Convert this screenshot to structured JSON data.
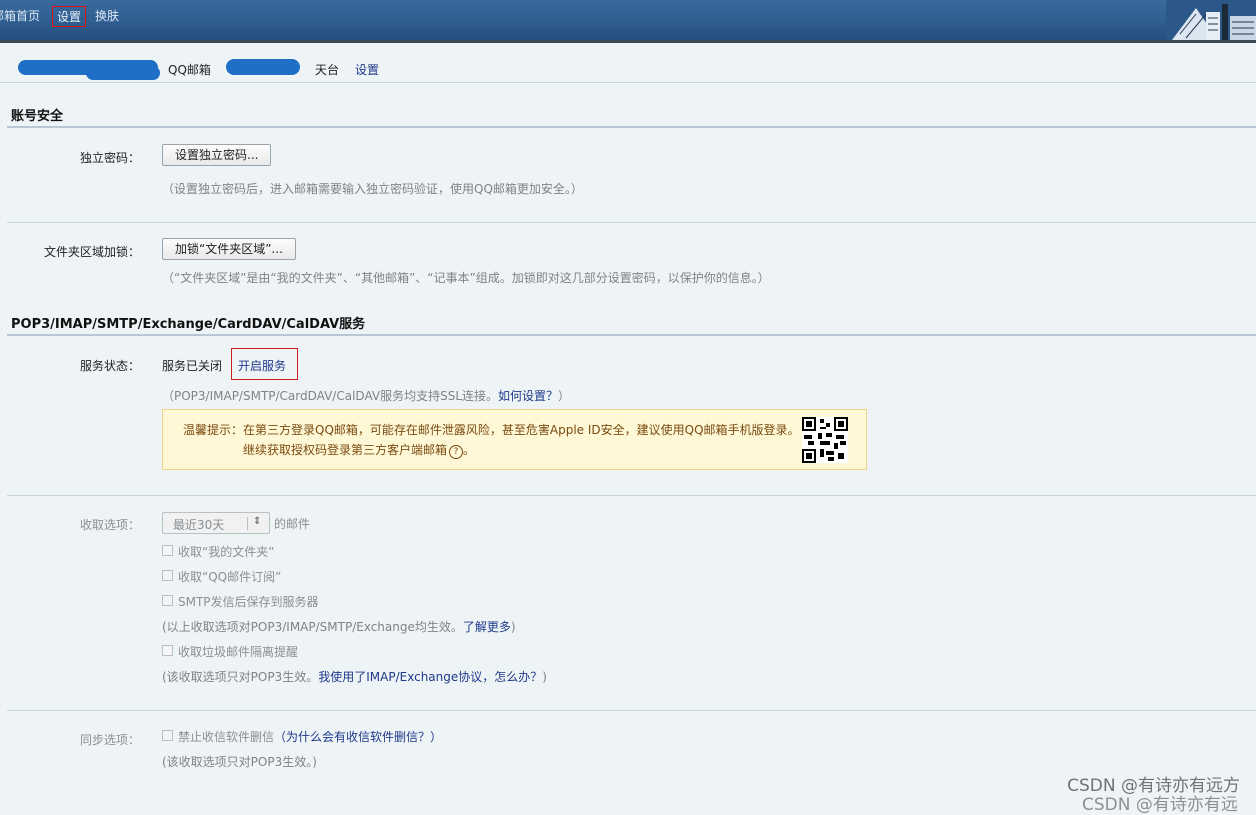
{
  "topnav": {
    "home": "邮箱首页",
    "settings": "设置",
    "skin": "换肤"
  },
  "account": {
    "product": "QQ邮箱",
    "tiantai": "天台",
    "settings_link": "设置"
  },
  "security": {
    "title": "账号安全",
    "independent_password": {
      "label": "独立密码：",
      "button": "设置独立密码...",
      "hint": "（设置独立密码后，进入邮箱需要输入独立密码验证，使用QQ邮箱更加安全。）"
    },
    "folder_lock": {
      "label": "文件夹区域加锁：",
      "button": "加锁“文件夹区域”...",
      "hint": "（“文件夹区域”是由“我的文件夹”、“其他邮箱”、“记事本”组成。加锁即对这几部分设置密码，以保护你的信息。）"
    }
  },
  "service": {
    "title": "POP3/IMAP/SMTP/Exchange/CardDAV/CalDAV服务",
    "status_label": "服务状态：",
    "status_value": "服务已关闭",
    "enable_link": "开启服务",
    "ssl_hint": "（POP3/IMAP/SMTP/CardDAV/CalDAV服务均支持SSL连接。",
    "ssl_link": "如何设置？",
    "ssl_close": "）",
    "warning_line1": "温馨提示：在第三方登录QQ邮箱，可能存在邮件泄露风险，甚至危害Apple ID安全，建议使用QQ邮箱手机版登录。",
    "warning_line2": "继续获取授权码登录第三方客户端邮箱",
    "warning_q": "?",
    "warning_end": "。"
  },
  "receive": {
    "label": "收取选项：",
    "select_value": "最近30天",
    "suffix": "的邮件",
    "opt1": "收取“我的文件夹”",
    "opt2": "收取“QQ邮件订阅”",
    "opt3": "SMTP发信后保存到服务器",
    "note1": "(以上收取选项对POP3/IMAP/SMTP/Exchange均生效。",
    "note1_link": "了解更多",
    "note1_close": ")",
    "opt4": "收取垃圾邮件隔离提醒",
    "note2": "(该收取选项只对POP3生效。",
    "note2_link": "我使用了IMAP/Exchange协议，怎么办？",
    "note2_close": ")"
  },
  "sync": {
    "label": "同步选项：",
    "opt": "禁止收信软件删信",
    "link": "（为什么会有收信软件删信？）",
    "note": "(该收取选项只对POP3生效。)"
  },
  "watermark": "CSDN @有诗亦有远方",
  "watermark2": "CSDN @有诗亦有远"
}
